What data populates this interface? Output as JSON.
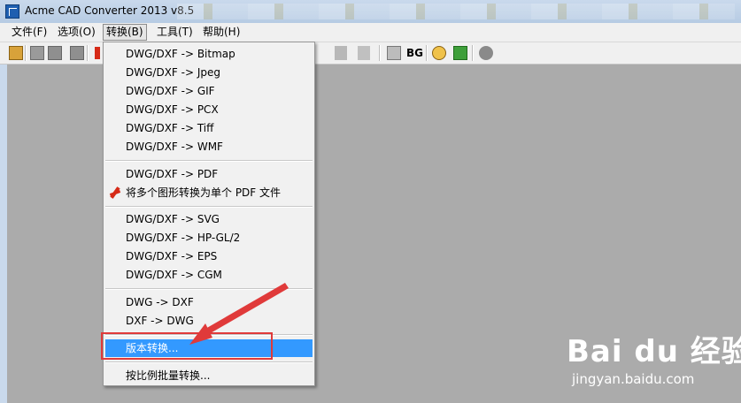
{
  "window": {
    "title": "Acme CAD Converter 2013 v8.5"
  },
  "menubar": [
    {
      "label": "文件(F)"
    },
    {
      "label": "选项(O)"
    },
    {
      "label": "转换(B)"
    },
    {
      "label": "工具(T)"
    },
    {
      "label": "帮助(H)"
    }
  ],
  "toolbar": {
    "bg_label": "BG"
  },
  "convert_menu": {
    "items": [
      "DWG/DXF -> Bitmap",
      "DWG/DXF -> Jpeg",
      "DWG/DXF -> GIF",
      "DWG/DXF -> PCX",
      "DWG/DXF -> Tiff",
      "DWG/DXF -> WMF",
      "DWG/DXF -> PDF",
      "将多个图形转换为单个 PDF 文件",
      "DWG/DXF -> SVG",
      "DWG/DXF -> HP-GL/2",
      "DWG/DXF -> EPS",
      "DWG/DXF -> CGM",
      "DWG -> DXF",
      "DXF -> DWG",
      "版本转换...",
      "按比例批量转换..."
    ],
    "highlighted_index": 14
  },
  "colors": {
    "highlight": "#3399ff",
    "annotation": "#e03a3a"
  },
  "watermark": {
    "logo": "Bai du 经验",
    "sub": "jingyan.baidu.com"
  }
}
